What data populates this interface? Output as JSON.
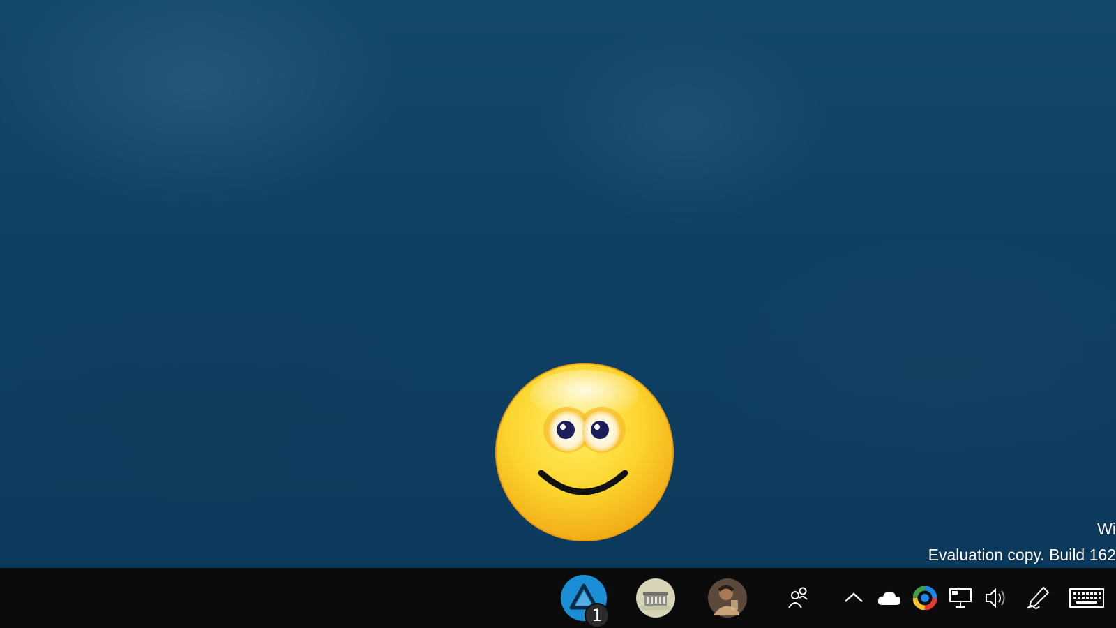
{
  "watermark": {
    "line1": "Wi",
    "line2": "Evaluation copy. Build 162"
  },
  "desktop": {
    "emoticon_name": "skype-smile-emoticon"
  },
  "taskbar": {
    "apps": [
      {
        "name": "arrow-app",
        "icon": "triangle-app-icon",
        "badge": "1",
        "color": "#1a8fd6"
      },
      {
        "name": "building-app",
        "icon": "building-avatar-icon"
      },
      {
        "name": "person-app",
        "icon": "person-avatar-icon"
      }
    ],
    "tray": [
      {
        "name": "people",
        "icon": "people-icon"
      },
      {
        "name": "show-hidden",
        "icon": "chevron-up-icon"
      },
      {
        "name": "onedrive",
        "icon": "cloud-icon"
      },
      {
        "name": "color-app",
        "icon": "color-ring-icon"
      },
      {
        "name": "network",
        "icon": "network-icon"
      },
      {
        "name": "volume",
        "icon": "speaker-icon"
      },
      {
        "name": "pen-ink",
        "icon": "pen-icon"
      },
      {
        "name": "touch-keyboard",
        "icon": "keyboard-icon"
      }
    ]
  },
  "colors": {
    "desktop": "#0f4064",
    "taskbar": "#0b0b0b",
    "emoticon": "#f5c020",
    "accent": "#1a8fd6"
  }
}
